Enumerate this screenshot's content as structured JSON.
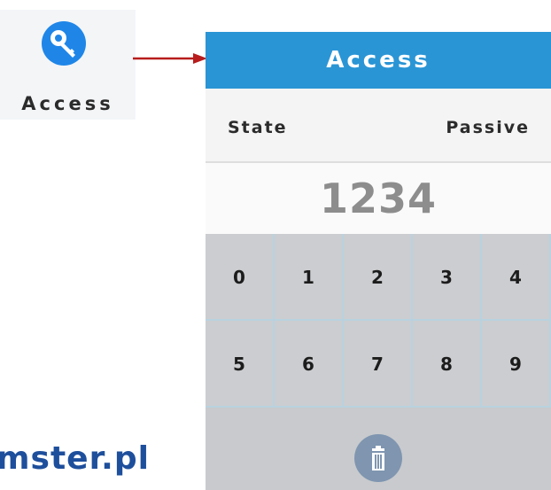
{
  "app_tile": {
    "label": "Access",
    "icon": "key-icon"
  },
  "panel": {
    "title": "Access",
    "state_label": "State",
    "state_value": "Passive",
    "code": "1234",
    "keys": [
      "0",
      "1",
      "2",
      "3",
      "4",
      "5",
      "6",
      "7",
      "8",
      "9"
    ],
    "delete_icon": "trash-icon"
  },
  "watermark": "mster.pl",
  "colors": {
    "header": "#2a95d5",
    "key_icon": "#1f86e8",
    "arrow": "#b81c1c",
    "keypad": "#cbcdd0",
    "trash_button": "#7f95b0",
    "watermark": "#1e4f9c"
  }
}
